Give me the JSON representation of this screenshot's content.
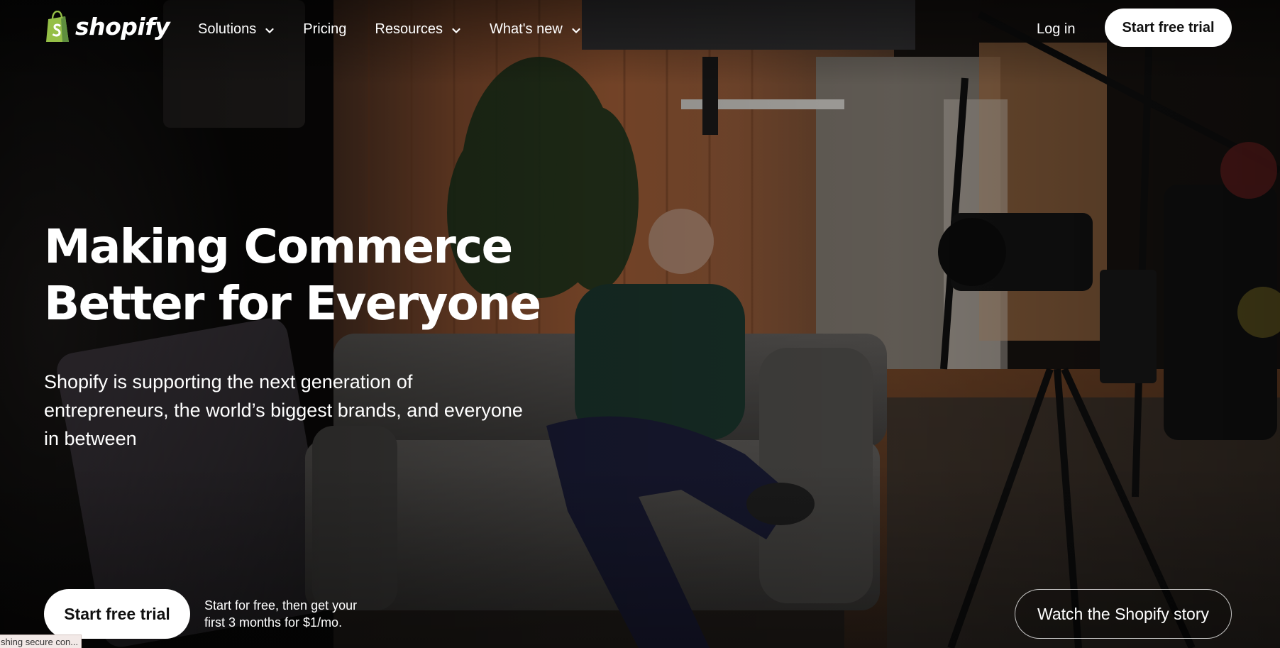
{
  "colors": {
    "brand_green": "#95bf47",
    "brand_green_dark": "#5e8e3e",
    "button_bg": "#ffffff",
    "button_text": "#111111",
    "text": "#ffffff"
  },
  "header": {
    "logo_text": "shopify",
    "logo_icon": "shopify-bag-icon",
    "nav": {
      "solutions": "Solutions",
      "pricing": "Pricing",
      "resources": "Resources",
      "whats_new": "What's new"
    },
    "dropdown_icon": "chevron-down-icon",
    "login": "Log in",
    "cta": "Start free trial"
  },
  "hero": {
    "title_line1": "Making Commerce",
    "title_line2": "Better for Everyone",
    "subtitle_line1": "Shopify is supporting the next generation of",
    "subtitle_line2": "entrepreneurs, the world’s biggest brands, and everyone",
    "subtitle_line3": "in between",
    "cta": "Start free trial",
    "cta_note_line1": "Start for free, then get your",
    "cta_note_line2": "first 3 months for $1/mo.",
    "watch": "Watch the Shopify story"
  },
  "status_bar": "shing secure con..."
}
